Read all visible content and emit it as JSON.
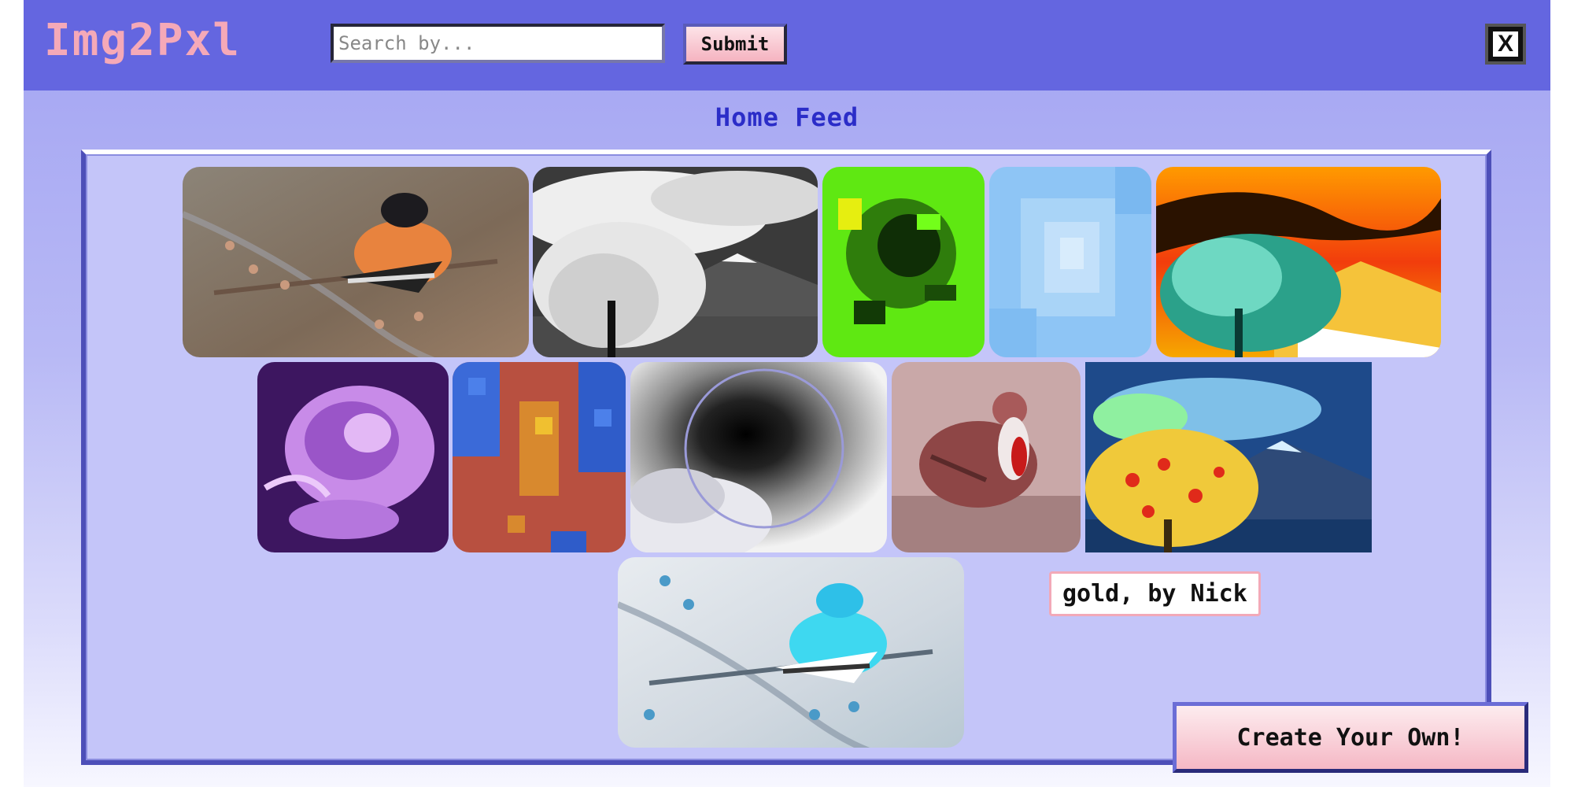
{
  "app": {
    "logo": "Img2Pxl",
    "search": {
      "placeholder": "Search by...",
      "value": ""
    },
    "submit_label": "Submit",
    "close_label": "X"
  },
  "feed": {
    "title": "Home Feed",
    "tooltip": "gold, by Nick",
    "images": [
      {
        "name": "orange-bird-image"
      },
      {
        "name": "grayscale-mountain-image"
      },
      {
        "name": "green-pixel-rose-image"
      },
      {
        "name": "blue-pixel-sky-image"
      },
      {
        "name": "inverted-sunset-mountain-image"
      },
      {
        "name": "purple-rose-image"
      },
      {
        "name": "pixel-mosaic-image"
      },
      {
        "name": "inverted-dark-sky-image"
      },
      {
        "name": "red-dove-image"
      },
      {
        "name": "gold-tree-mountain-image"
      },
      {
        "name": "inverted-blue-bird-image"
      }
    ]
  },
  "create_label": "Create Your Own!"
}
